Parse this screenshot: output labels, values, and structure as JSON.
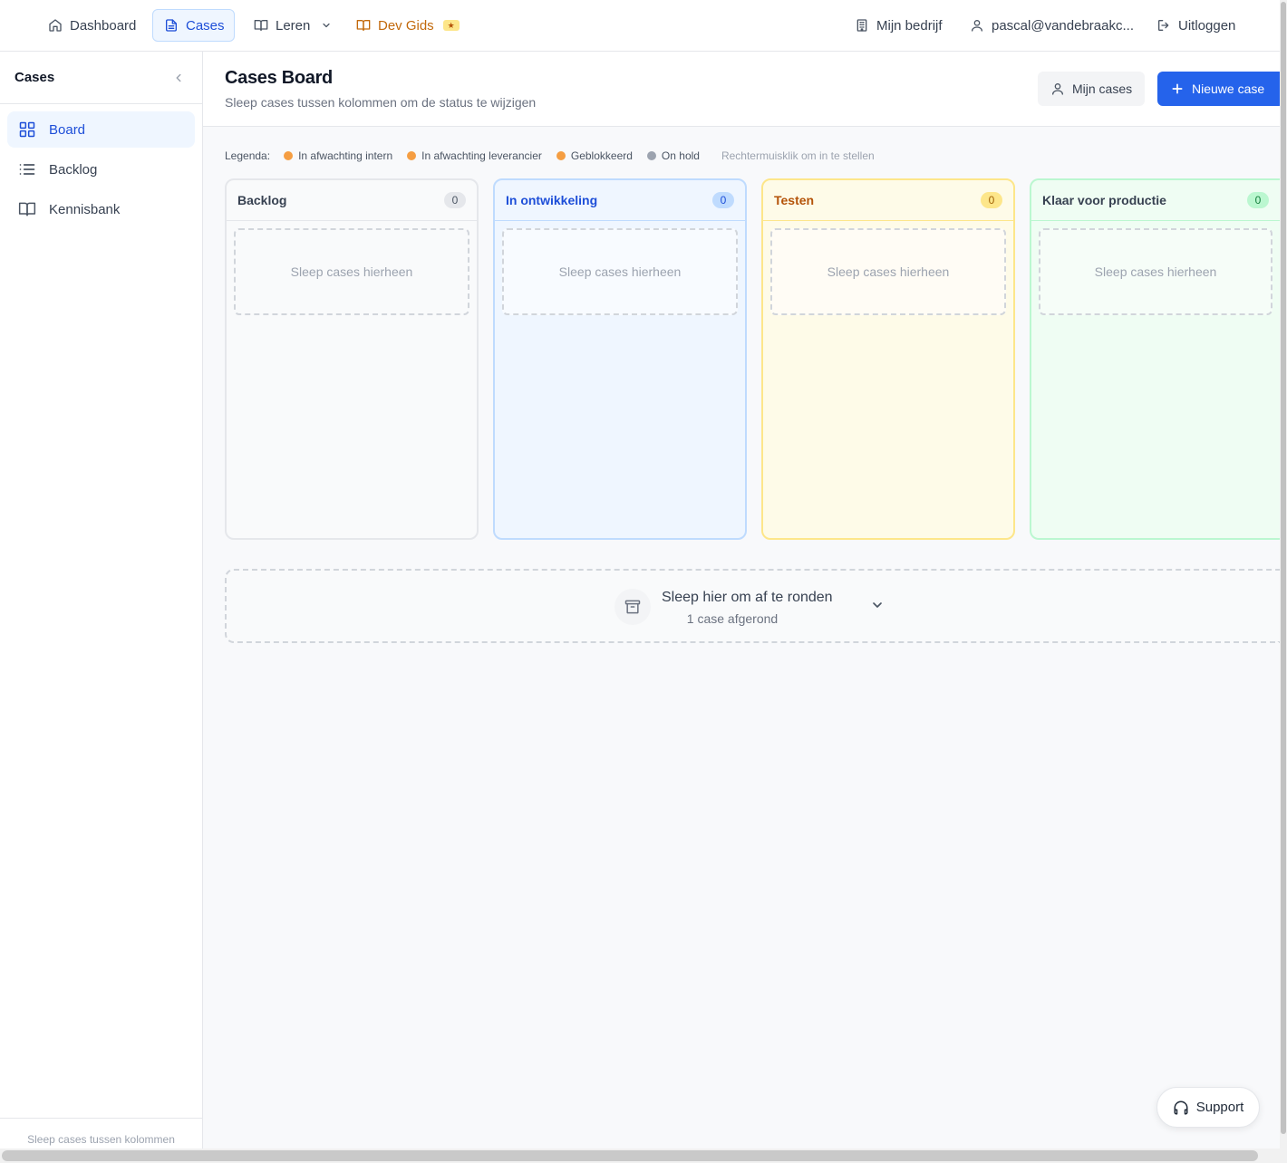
{
  "topnav": {
    "items": [
      {
        "label": "Dashboard",
        "icon": "home-icon"
      },
      {
        "label": "Cases",
        "icon": "document-icon",
        "active": true
      },
      {
        "label": "Leren",
        "icon": "book-open-icon",
        "has_dropdown": true
      },
      {
        "label": "Dev Gids",
        "icon": "book-open-icon",
        "badge": "★"
      }
    ],
    "right_items": [
      {
        "label": "Mijn bedrijf",
        "icon": "building-icon"
      },
      {
        "label": "pascal@vandebraakc...",
        "icon": "user-icon"
      },
      {
        "label": "Uitloggen",
        "icon": "logout-icon"
      }
    ]
  },
  "sidebar": {
    "title": "Cases",
    "items": [
      {
        "label": "Board",
        "icon": "grid-icon",
        "active": true
      },
      {
        "label": "Backlog",
        "icon": "list-icon"
      },
      {
        "label": "Kennisbank",
        "icon": "book-open-icon"
      }
    ],
    "footer": "Sleep cases tussen kolommen"
  },
  "header": {
    "title": "Cases Board",
    "subtitle": "Sleep cases tussen kolommen om de status te wijzigen",
    "my_cases_label": "Mijn cases",
    "new_case_label": "Nieuwe case"
  },
  "legend": {
    "label": "Legenda:",
    "items": [
      {
        "label": "In afwachting intern",
        "color": "#f59e42"
      },
      {
        "label": "In afwachting leverancier",
        "color": "#f59e42"
      },
      {
        "label": "Geblokkeerd",
        "color": "#f59e42"
      },
      {
        "label": "On hold",
        "color": "#9ca3af"
      }
    ],
    "hint": "Rechtermuisklik om in te stellen"
  },
  "columns": [
    {
      "title": "Backlog",
      "count": "0",
      "dropzone": "Sleep cases hierheen",
      "color": "#374151"
    },
    {
      "title": "In ontwikkeling",
      "count": "0",
      "dropzone": "Sleep cases hierheen",
      "color": "#1d4ed8"
    },
    {
      "title": "Testen",
      "count": "0",
      "dropzone": "Sleep cases hierheen",
      "color": "#b45309"
    },
    {
      "title": "Klaar voor productie",
      "count": "0",
      "dropzone": "Sleep cases hierheen",
      "color": "#15803d"
    }
  ],
  "complete": {
    "title": "Sleep hier om af te ronden",
    "subtitle": "1 case afgerond"
  },
  "support": {
    "label": "Support"
  },
  "colors": {
    "accent": "#2563eb",
    "accent_light": "#eff6ff"
  }
}
